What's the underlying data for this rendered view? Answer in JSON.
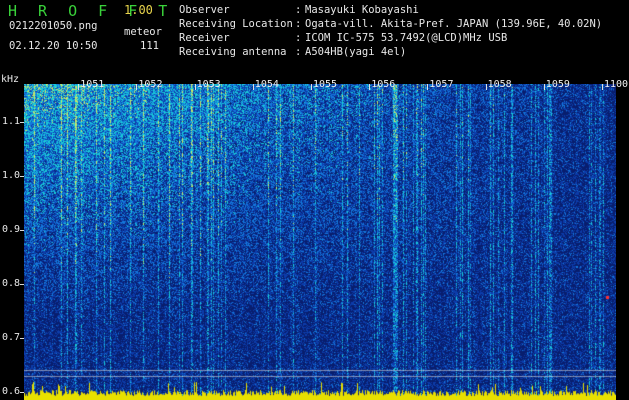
{
  "header": {
    "app_title": "H R O F F T",
    "app_version": "1.00",
    "filename": "0212201050.png",
    "datetime": "02.12.20 10:50",
    "count_label": "meteor",
    "count_value": "111"
  },
  "station_info": [
    {
      "label": "Observer",
      "sep": ":",
      "value": "Masayuki Kobayashi"
    },
    {
      "label": "Receiving Location",
      "sep": ":",
      "value": "Ogata-vill. Akita-Pref. JAPAN (139.96E, 40.02N)"
    },
    {
      "label": "Receiver",
      "sep": ":",
      "value": "ICOM IC-575 53.7492(@LCD)MHz USB"
    },
    {
      "label": "Receiving antenna",
      "sep": ":",
      "value": "A504HB(yagi 4el)"
    }
  ],
  "spectrogram": {
    "y_unit": "kHz",
    "y_ticks": [
      "1.1",
      "1.0",
      "0.9",
      "0.8",
      "0.7",
      "0.6"
    ],
    "y_tick_values": [
      1.1,
      1.0,
      0.9,
      0.8,
      0.7,
      0.6
    ],
    "y_range": [
      0.585,
      1.17
    ],
    "minute_labels": [
      "1051",
      "1052",
      "1053",
      "1054",
      "1055",
      "1056",
      "1057",
      "1058",
      "1059",
      "1100"
    ],
    "minute_range": [
      1050,
      1100
    ],
    "colors": {
      "background": "#082a7c",
      "signal": "#19d2d8",
      "strong": "#c8e86a",
      "baseline": "#e8e000",
      "marker": "#ff3030"
    }
  }
}
